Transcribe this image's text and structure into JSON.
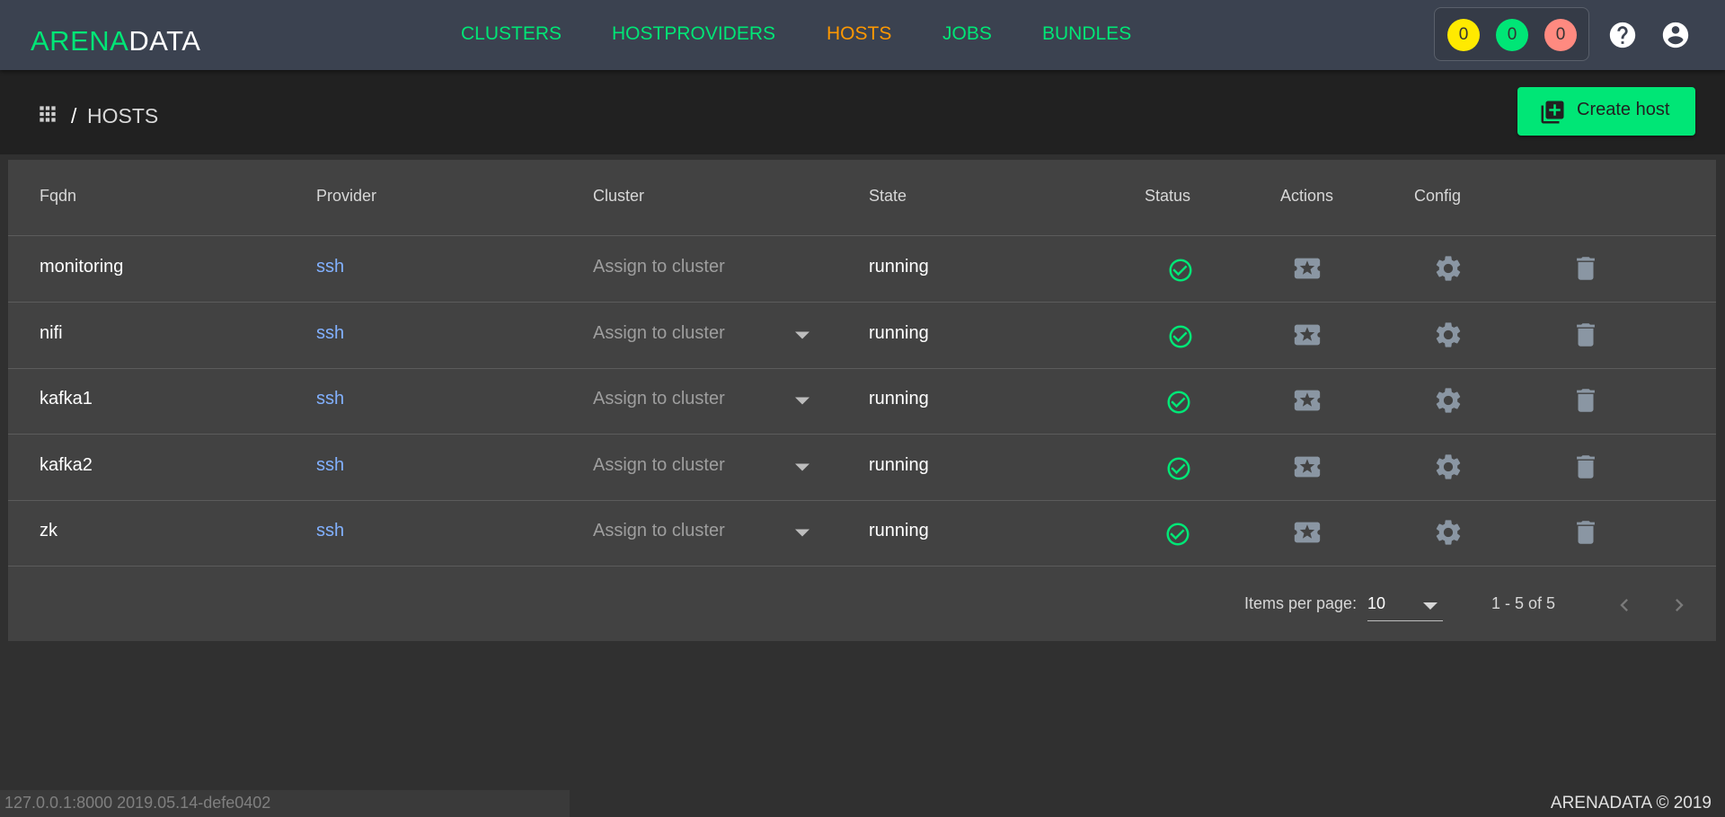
{
  "app": {
    "logo_part1": "ARENA",
    "logo_part2": "DATA",
    "nav": [
      {
        "label": "CLUSTERS",
        "active": false
      },
      {
        "label": "HOSTPROVIDERS",
        "active": false
      },
      {
        "label": "HOSTS",
        "active": true
      },
      {
        "label": "JOBS",
        "active": false
      },
      {
        "label": "BUNDLES",
        "active": false
      }
    ],
    "counters": {
      "yellow": "0",
      "green": "0",
      "red": "0"
    },
    "icons": {
      "help": "help-circle-icon",
      "account": "account-circle-icon"
    }
  },
  "colors": {
    "accent": "#00e676",
    "active_nav": "#ff9800",
    "link": "#82b1ff",
    "topbar": "#3b4250",
    "card": "#424242",
    "background": "#303030"
  },
  "breadcrumb": {
    "separator": "/",
    "title": "HOSTS",
    "icon": "apps-grid-icon"
  },
  "create_button": {
    "label": "Create host",
    "icon": "library-add-icon"
  },
  "table": {
    "headers": [
      "Fqdn",
      "Provider",
      "Cluster",
      "State",
      "Status",
      "Actions",
      "Config"
    ],
    "rows": [
      {
        "fqdn": "monitoring",
        "provider": "ssh",
        "cluster": "Assign to cluster",
        "state": "running",
        "has_dropdown": false
      },
      {
        "fqdn": "nifi",
        "provider": "ssh",
        "cluster": "Assign to cluster",
        "state": "running",
        "has_dropdown": true
      },
      {
        "fqdn": "kafka1",
        "provider": "ssh",
        "cluster": "Assign to cluster",
        "state": "running",
        "has_dropdown": true
      },
      {
        "fqdn": "kafka2",
        "provider": "ssh",
        "cluster": "Assign to cluster",
        "state": "running",
        "has_dropdown": true
      },
      {
        "fqdn": "zk",
        "provider": "ssh",
        "cluster": "Assign to cluster",
        "state": "running",
        "has_dropdown": true
      }
    ],
    "row_icons": {
      "status": "check-circle-icon",
      "actions": "ticket-star-icon",
      "config": "gear-icon",
      "delete": "trash-icon"
    }
  },
  "paginator": {
    "items_label": "Items per page:",
    "page_size": "10",
    "range": "1 - 5 of 5"
  },
  "footer": {
    "version": "127.0.0.1:8000 2019.05.14-defe0402",
    "copyright": "ARENADATA © 2019"
  }
}
